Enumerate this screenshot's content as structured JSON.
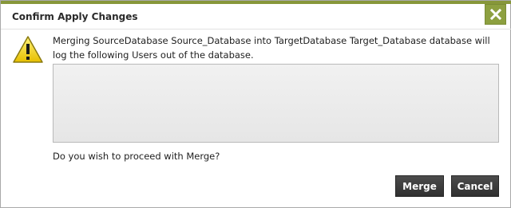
{
  "dialog": {
    "title": "Confirm Apply Changes",
    "close_icon": "close-icon",
    "warning_icon": "warning-icon",
    "message": "Merging SourceDatabase Source_Database into TargetDatabase Target_Database database will log the following Users out of the database.",
    "users": [],
    "question": "Do you wish to proceed with Merge?",
    "buttons": {
      "merge_label": "Merge",
      "cancel_label": "Cancel"
    }
  },
  "colors": {
    "accent": "#87973a",
    "button_dark": "#3a3a3a",
    "warning_yellow": "#f2d21a"
  }
}
